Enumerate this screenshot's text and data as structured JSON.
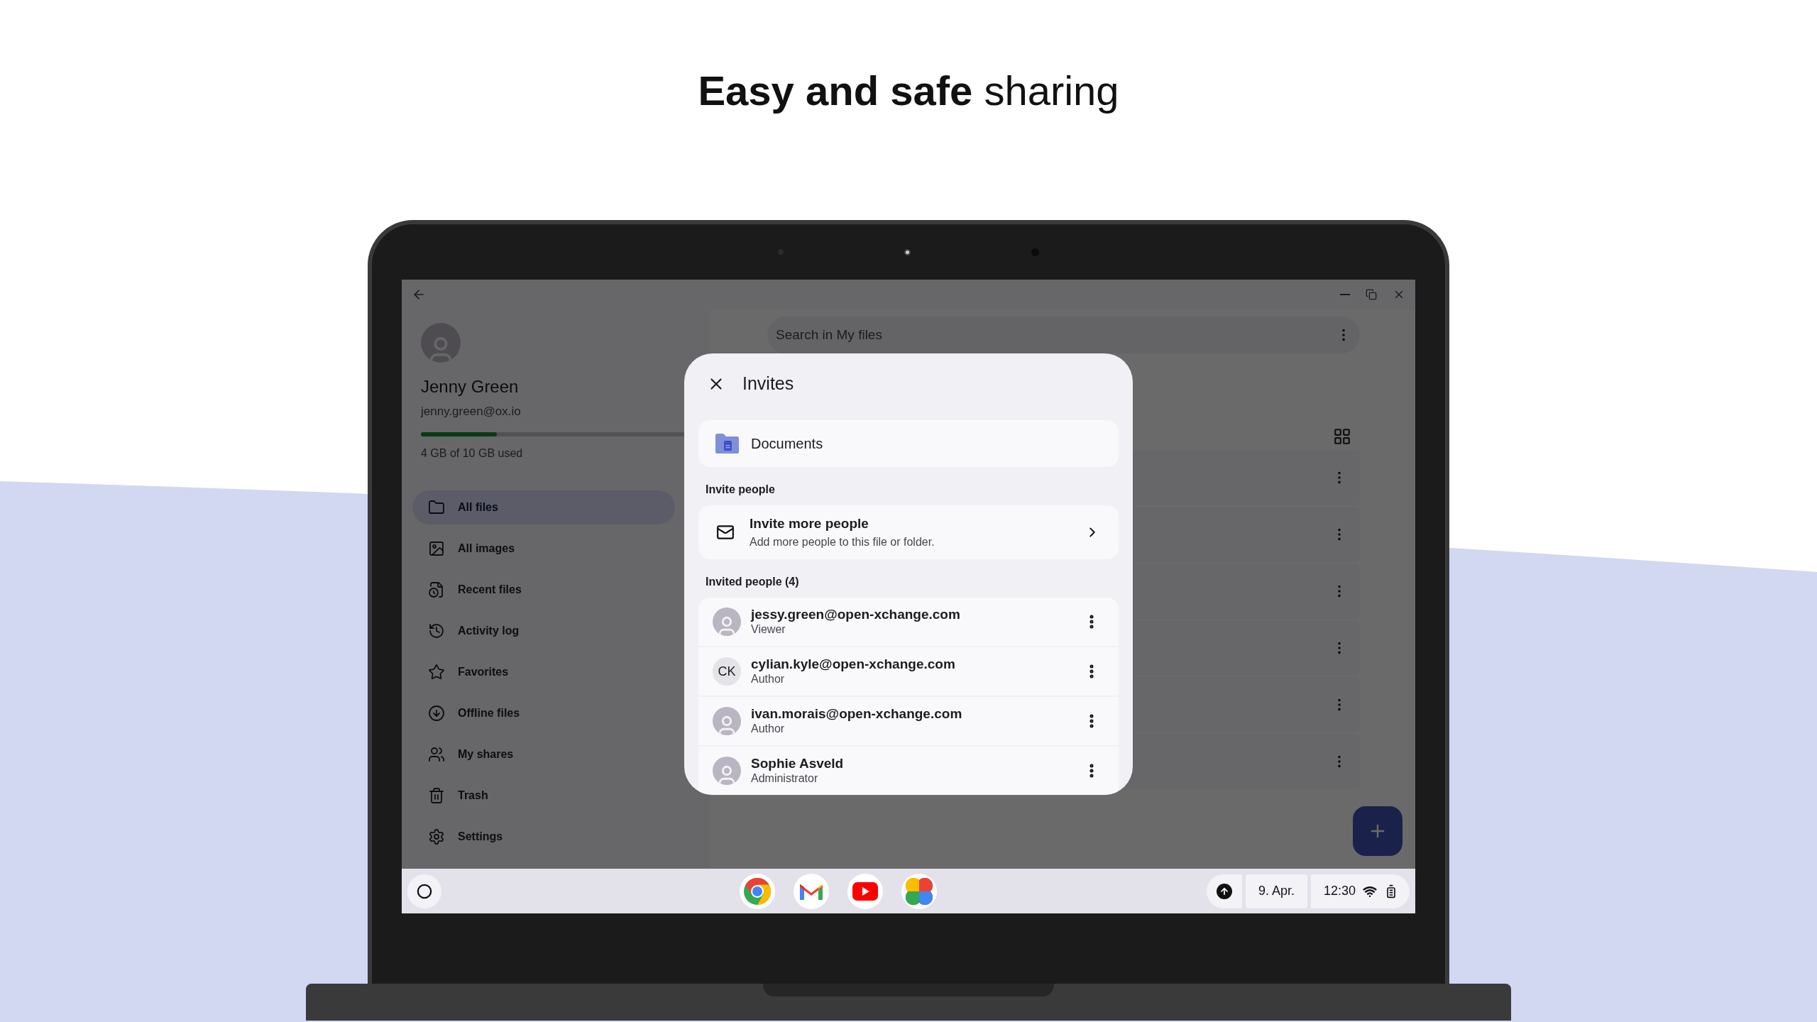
{
  "headline": "**Easy and safe** sharing",
  "app": {
    "profile": {
      "name": "Jenny Green",
      "email": "jenny.green@ox.io",
      "storage": {
        "level": 0.26
      },
      "usage": "4 GB of 10 GB used"
    },
    "nav": [
      {
        "label": "All files",
        "kind": "folder",
        "selected": true
      },
      {
        "label": "All images",
        "kind": "image",
        "selected": false
      },
      {
        "label": "Recent files",
        "kind": "recent",
        "selected": false
      },
      {
        "label": "Activity log",
        "kind": "history",
        "selected": false
      },
      {
        "label": "Favorites",
        "kind": "star",
        "selected": false
      },
      {
        "label": "Offline files",
        "kind": "download",
        "selected": false
      },
      {
        "label": "My shares",
        "kind": "people",
        "selected": false
      },
      {
        "label": "Trash",
        "kind": "trash",
        "selected": false
      },
      {
        "label": "Settings",
        "kind": "settings",
        "selected": false
      }
    ],
    "search": {
      "placeholder": "Search in My files"
    }
  },
  "dialog": {
    "title": "Invites",
    "item": "Documents",
    "invite_section": "Invite people",
    "invite": {
      "title": "Invite more people",
      "subtitle": "Add more people to this file or folder."
    },
    "invited_section": "Invited people (4)",
    "people": [
      {
        "name": "jessy.green@open-xchange.com",
        "role": "Viewer",
        "kind": "photo"
      },
      {
        "name": "cylian.kyle@open-xchange.com",
        "role": "Author",
        "kind": "initials",
        "initials": "CK"
      },
      {
        "name": "ivan.morais@open-xchange.com",
        "role": "Author",
        "kind": "photo"
      },
      {
        "name": "Sophie Asveld",
        "role": "Administrator",
        "kind": "photo"
      }
    ]
  },
  "taskbar": {
    "apps": [
      {
        "kind": "chrome"
      },
      {
        "kind": "gmail"
      },
      {
        "kind": "youtube"
      },
      {
        "kind": "photos"
      }
    ],
    "date": "9. Apr.",
    "time": "12:30"
  }
}
